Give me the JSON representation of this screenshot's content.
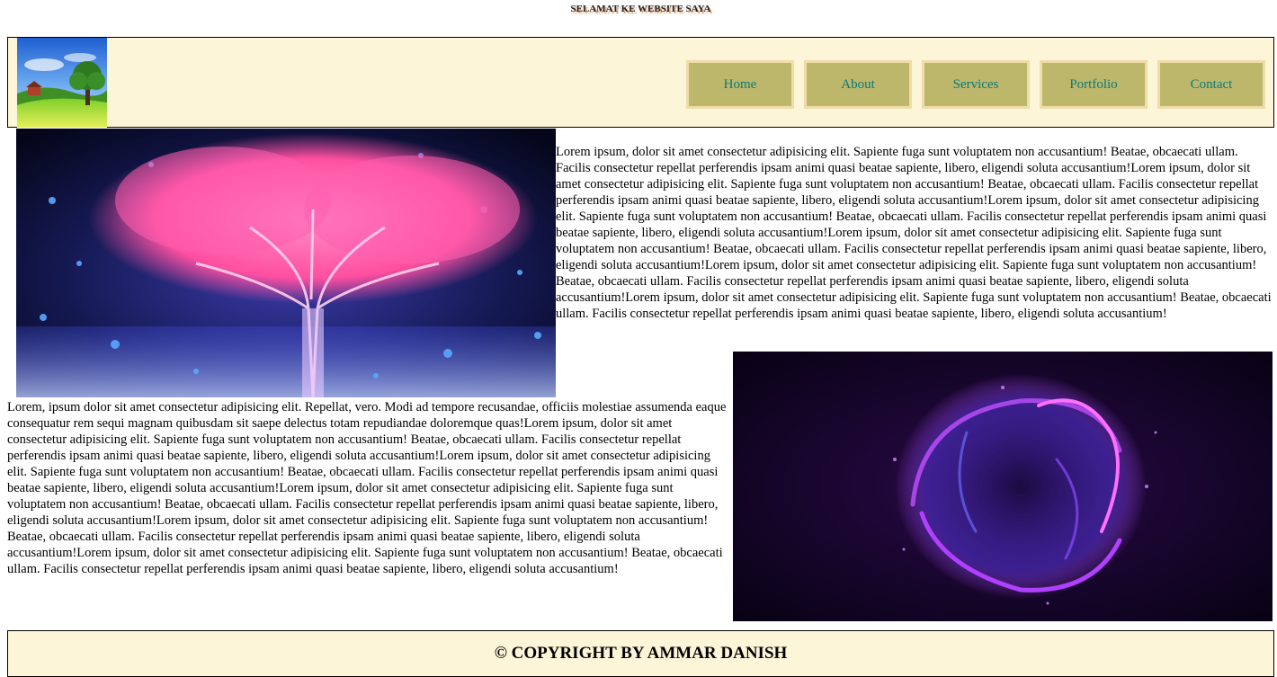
{
  "page": {
    "welcome_text": "SELAMAT KE WEBSITE SAYA"
  },
  "header": {
    "logo_alt": "landscape logo",
    "nav": [
      {
        "label": "Home"
      },
      {
        "label": "About"
      },
      {
        "label": "Services"
      },
      {
        "label": "Portfolio"
      },
      {
        "label": "Contact"
      }
    ]
  },
  "main": {
    "image1_alt": "glowing digital tree",
    "paragraph1": "Lorem ipsum, dolor sit amet consectetur adipisicing elit. Sapiente fuga sunt voluptatem non accusantium! Beatae, obcaecati ullam. Facilis consectetur repellat perferendis ipsam animi quasi beatae sapiente, libero, eligendi soluta accusantium!Lorem ipsum, dolor sit amet consectetur adipisicing elit. Sapiente fuga sunt voluptatem non accusantium! Beatae, obcaecati ullam. Facilis consectetur repellat perferendis ipsam animi quasi beatae sapiente, libero, eligendi soluta accusantium!Lorem ipsum, dolor sit amet consectetur adipisicing elit. Sapiente fuga sunt voluptatem non accusantium! Beatae, obcaecati ullam. Facilis consectetur repellat perferendis ipsam animi quasi beatae sapiente, libero, eligendi soluta accusantium!Lorem ipsum, dolor sit amet consectetur adipisicing elit. Sapiente fuga sunt voluptatem non accusantium! Beatae, obcaecati ullam. Facilis consectetur repellat perferendis ipsam animi quasi beatae sapiente, libero, eligendi soluta accusantium!Lorem ipsum, dolor sit amet consectetur adipisicing elit. Sapiente fuga sunt voluptatem non accusantium! Beatae, obcaecati ullam. Facilis consectetur repellat perferendis ipsam animi quasi beatae sapiente, libero, eligendi soluta accusantium!Lorem ipsum, dolor sit amet consectetur adipisicing elit. Sapiente fuga sunt voluptatem non accusantium! Beatae, obcaecati ullam. Facilis consectetur repellat perferendis ipsam animi quasi beatae sapiente, libero, eligendi soluta accusantium!",
    "image2_alt": "glowing purple sphere",
    "paragraph2": "Lorem, ipsum dolor sit amet consectetur adipisicing elit. Repellat, vero. Modi ad tempore recusandae, officiis molestiae assumenda eaque consequatur rem sequi magnam quibusdam sit saepe delectus totam repudiandae doloremque quas!Lorem ipsum, dolor sit amet consectetur adipisicing elit. Sapiente fuga sunt voluptatem non accusantium! Beatae, obcaecati ullam. Facilis consectetur repellat perferendis ipsam animi quasi beatae sapiente, libero, eligendi soluta accusantium!Lorem ipsum, dolor sit amet consectetur adipisicing elit. Sapiente fuga sunt voluptatem non accusantium! Beatae, obcaecati ullam. Facilis consectetur repellat perferendis ipsam animi quasi beatae sapiente, libero, eligendi soluta accusantium!Lorem ipsum, dolor sit amet consectetur adipisicing elit. Sapiente fuga sunt voluptatem non accusantium! Beatae, obcaecati ullam. Facilis consectetur repellat perferendis ipsam animi quasi beatae sapiente, libero, eligendi soluta accusantium!Lorem ipsum, dolor sit amet consectetur adipisicing elit. Sapiente fuga sunt voluptatem non accusantium! Beatae, obcaecati ullam. Facilis consectetur repellat perferendis ipsam animi quasi beatae sapiente, libero, eligendi soluta accusantium!Lorem ipsum, dolor sit amet consectetur adipisicing elit. Sapiente fuga sunt voluptatem non accusantium! Beatae, obcaecati ullam. Facilis consectetur repellat perferendis ipsam animi quasi beatae sapiente, libero, eligendi soluta accusantium!"
  },
  "footer": {
    "copyright": "© COPYRIGHT BY AMMAR DANISH"
  },
  "colors": {
    "header_bg": "#fdf5d8",
    "nav_bg": "#bdb76b",
    "nav_border": "#f0dca8",
    "nav_text": "#0a7a7a"
  }
}
